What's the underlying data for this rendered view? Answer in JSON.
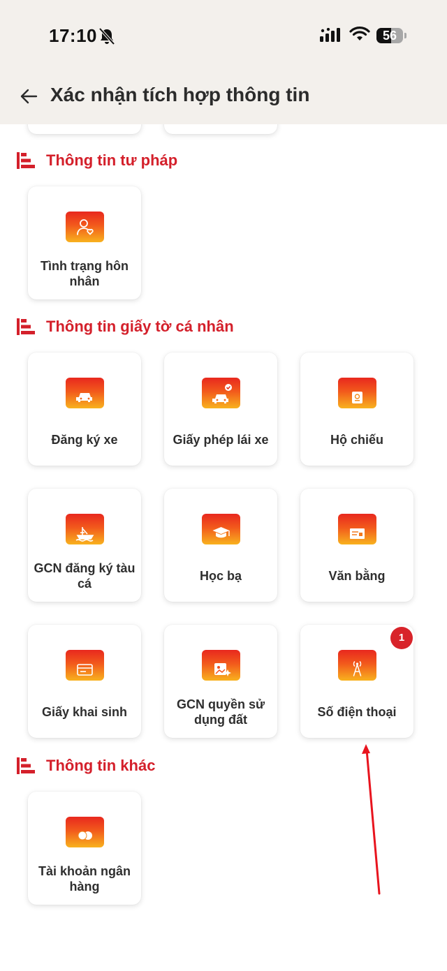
{
  "status_bar": {
    "time": "17:10",
    "battery": "56",
    "battery_level_percent": 56
  },
  "header": {
    "title": "Xác nhận tích hợp thông tin"
  },
  "sections": [
    {
      "title": "Thông tin tư pháp",
      "items": [
        {
          "label": "Tình trạng hôn nhân"
        }
      ]
    },
    {
      "title": "Thông tin giấy tờ cá nhân",
      "items": [
        {
          "label": "Đăng ký xe"
        },
        {
          "label": "Giấy phép lái xe"
        },
        {
          "label": "Hộ chiếu"
        },
        {
          "label": "GCN đăng ký tàu cá"
        },
        {
          "label": "Học bạ"
        },
        {
          "label": "Văn bằng"
        },
        {
          "label": "Giấy khai sinh"
        },
        {
          "label": "GCN quyền sử dụng đất"
        },
        {
          "label": "Số điện thoại",
          "badge": "1"
        }
      ]
    },
    {
      "title": "Thông tin khác",
      "items": [
        {
          "label": "Tài khoản ngân hàng"
        }
      ]
    }
  ],
  "colors": {
    "accent": "#d4202b",
    "icon_gradient_top": "#e8281e",
    "icon_gradient_bottom": "#f8b21e",
    "header_bg": "#f3f0ec"
  },
  "icons": {
    "marital-status": "person-heart-icon",
    "vehicle-registration": "car-icon",
    "driver-license": "car-check-icon",
    "passport": "passport-icon",
    "fishing-vessel": "ship-icon",
    "school-record": "graduation-cap-icon",
    "diploma": "certificate-icon",
    "birth-certificate": "id-card-icon",
    "land-rights": "land-certificate-icon",
    "phone-number": "antenna-icon",
    "bank-account": "coins-icon"
  }
}
